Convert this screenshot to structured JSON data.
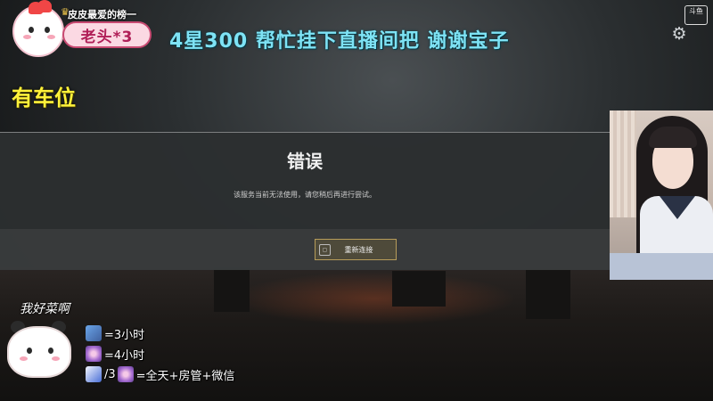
{
  "overlay": {
    "rank_title": "皮皮最爱的榜一",
    "rank_name": "老头*3",
    "banner": "4星300 帮忙挂下直播间把  谢谢宝子",
    "seat_notice": "有车位",
    "platform_logo": "斗鱼"
  },
  "dialog": {
    "title": "错误",
    "message": "该服务当前无法使用，请您稍后再进行尝试。",
    "reconnect_label": "重新连接"
  },
  "legend": {
    "caption": "我好菜啊",
    "rows": [
      {
        "icon": "plane-gift-icon",
        "text": "=3小时"
      },
      {
        "icon": "flower-gift-icon",
        "text": "=4小时"
      },
      {
        "icon": "rocket-gift-icon",
        "text": "/3",
        "text2": "=全天+房管+微信"
      }
    ]
  },
  "icons": {
    "settings": "gear-icon"
  },
  "colors": {
    "banner_text": "#7ee3f5",
    "seat_text": "#fff23a",
    "rank_pill_text": "#b01e57",
    "button_border": "#b79c5a"
  }
}
